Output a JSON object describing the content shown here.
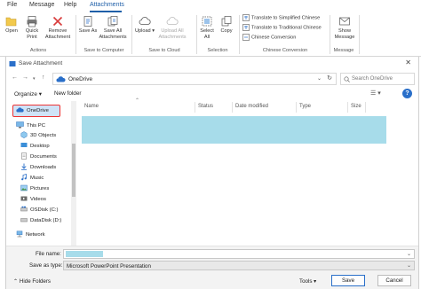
{
  "ribbon": {
    "menu": {
      "file": "File",
      "message": "Message",
      "help": "Help",
      "attachments": "Attachments"
    },
    "buttons": {
      "open": "Open",
      "quick_print": "Quick Print",
      "remove_attachment": "Remove Attachment",
      "save_as": "Save As",
      "save_all_attachments": "Save All Attachments",
      "upload": "Upload",
      "upload_all_attachments": "Upload All Attachments",
      "select_all": "Select All",
      "copy": "Copy",
      "translate_simplified": "Translate to Simplified Chinese",
      "translate_traditional": "Translate to Traditional Chinese",
      "chinese_conversion": "Chinese Conversion",
      "show_message": "Show Message"
    },
    "groups": {
      "actions": "Actions",
      "save_to_computer": "Save to Computer",
      "save_to_cloud": "Save to Cloud",
      "selection": "Selection",
      "chinese_conversion": "Chinese Conversion",
      "message": "Message"
    }
  },
  "dialog": {
    "title": "Save Attachment",
    "close": "✕",
    "address": "OneDrive",
    "search_placeholder": "Search OneDrive",
    "toolbar": {
      "organize": "Organize ▾",
      "new_folder": "New folder"
    },
    "nav": {
      "onedrive": "OneDrive",
      "this_pc": "This PC",
      "objects3d": "3D Objects",
      "desktop": "Desktop",
      "documents": "Documents",
      "downloads": "Downloads",
      "music": "Music",
      "pictures": "Pictures",
      "videos": "Videos",
      "osdisk": "OSDisk (C:)",
      "datadisk": "DataDisk (D:)",
      "network": "Network"
    },
    "columns": [
      "Name",
      "Status",
      "Date modified",
      "Type",
      "Size"
    ],
    "file_name_label": "File name:",
    "save_as_type_label": "Save as type:",
    "save_as_type_value": "Microsoft PowerPoint Presentation",
    "hide_folders": "Hide Folders",
    "tools": "Tools",
    "save": "Save",
    "cancel": "Cancel"
  },
  "colors": {
    "accent": "#1f5fa8",
    "selection": "#a7dcea",
    "highlight_border": "#e33333"
  }
}
